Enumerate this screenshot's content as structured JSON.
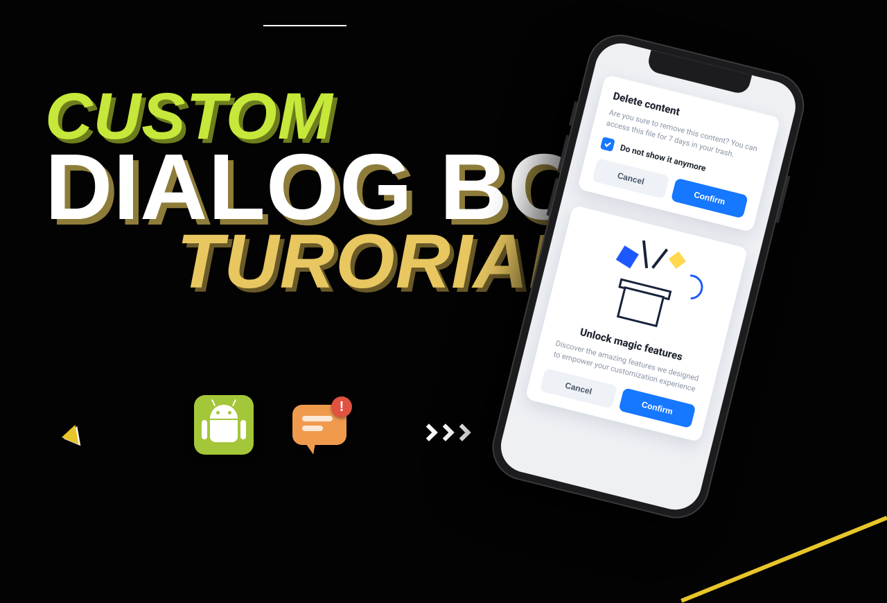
{
  "headline": {
    "line1": "CUSTOM",
    "line2": "DIALOG BOX",
    "line3": "TURORIAL"
  },
  "icons": {
    "android": "android-icon",
    "chat_alert": "chat-alert-icon"
  },
  "phone": {
    "dialog1": {
      "title": "Delete content",
      "body": "Are you sure to remove this content? You can access this file for 7 days in your trash.",
      "checkbox_label": "Do not show it anymore",
      "checkbox_checked": true,
      "cancel": "Cancel",
      "confirm": "Confirm"
    },
    "dialog2": {
      "title": "Unlock magic features",
      "body": "Discover the amazing features we designed to empower your customization experience",
      "cancel": "Cancel",
      "confirm": "Confirm"
    }
  },
  "colors": {
    "accent_yellow": "#e8c52a",
    "lime": "#c6e83a",
    "cream": "#e8c761",
    "primary_blue": "#1677ff",
    "android_green": "#a4c639",
    "chat_orange": "#f09a4e"
  }
}
